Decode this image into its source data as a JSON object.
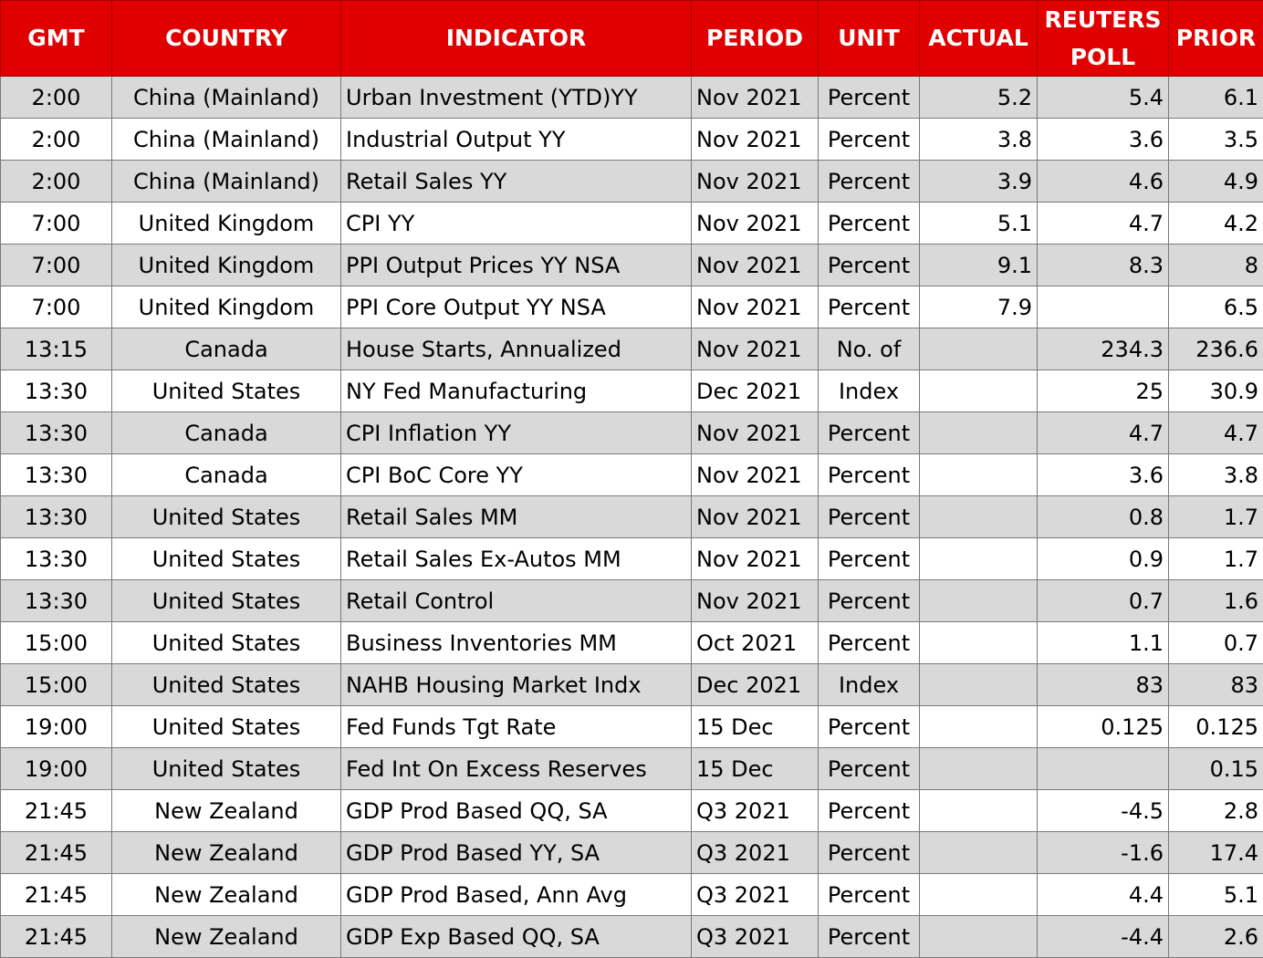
{
  "headers": {
    "gmt": "GMT",
    "country": "COUNTRY",
    "indicator": "INDICATOR",
    "period": "PERIOD",
    "unit": "UNIT",
    "actual": "ACTUAL",
    "reuters_poll": "REUTERS POLL",
    "prior": "PRIOR"
  },
  "colors": {
    "header_background": "#e00000",
    "header_text": "#ffffff",
    "row_shaded": "#d9d9d9",
    "row_plain": "#ffffff"
  },
  "rows": [
    {
      "gmt": "2:00",
      "country": "China (Mainland)",
      "indicator": "Urban Investment (YTD)YY",
      "period": "Nov 2021",
      "unit": "Percent",
      "actual": "5.2",
      "poll": "5.4",
      "prior": "6.1"
    },
    {
      "gmt": "2:00",
      "country": "China (Mainland)",
      "indicator": "Industrial Output YY",
      "period": "Nov 2021",
      "unit": "Percent",
      "actual": "3.8",
      "poll": "3.6",
      "prior": "3.5"
    },
    {
      "gmt": "2:00",
      "country": "China (Mainland)",
      "indicator": "Retail Sales YY",
      "period": "Nov 2021",
      "unit": "Percent",
      "actual": "3.9",
      "poll": "4.6",
      "prior": "4.9"
    },
    {
      "gmt": "7:00",
      "country": "United Kingdom",
      "indicator": "CPI YY",
      "period": "Nov 2021",
      "unit": "Percent",
      "actual": "5.1",
      "poll": "4.7",
      "prior": "4.2"
    },
    {
      "gmt": "7:00",
      "country": "United Kingdom",
      "indicator": "PPI Output Prices YY NSA",
      "period": "Nov 2021",
      "unit": "Percent",
      "actual": "9.1",
      "poll": "8.3",
      "prior": "8"
    },
    {
      "gmt": "7:00",
      "country": "United Kingdom",
      "indicator": "PPI Core Output YY NSA",
      "period": "Nov 2021",
      "unit": "Percent",
      "actual": "7.9",
      "poll": "",
      "prior": "6.5"
    },
    {
      "gmt": "13:15",
      "country": "Canada",
      "indicator": "House Starts, Annualized",
      "period": "Nov 2021",
      "unit": "No. of",
      "actual": "",
      "poll": "234.3",
      "prior": "236.6"
    },
    {
      "gmt": "13:30",
      "country": "United States",
      "indicator": "NY Fed Manufacturing",
      "period": "Dec 2021",
      "unit": "Index",
      "actual": "",
      "poll": "25",
      "prior": "30.9"
    },
    {
      "gmt": "13:30",
      "country": "Canada",
      "indicator": "CPI Inflation YY",
      "period": "Nov 2021",
      "unit": "Percent",
      "actual": "",
      "poll": "4.7",
      "prior": "4.7"
    },
    {
      "gmt": "13:30",
      "country": "Canada",
      "indicator": "CPI BoC Core YY",
      "period": "Nov 2021",
      "unit": "Percent",
      "actual": "",
      "poll": "3.6",
      "prior": "3.8"
    },
    {
      "gmt": "13:30",
      "country": "United States",
      "indicator": "Retail Sales MM",
      "period": "Nov 2021",
      "unit": "Percent",
      "actual": "",
      "poll": "0.8",
      "prior": "1.7"
    },
    {
      "gmt": "13:30",
      "country": "United States",
      "indicator": "Retail Sales Ex-Autos MM",
      "period": "Nov 2021",
      "unit": "Percent",
      "actual": "",
      "poll": "0.9",
      "prior": "1.7"
    },
    {
      "gmt": "13:30",
      "country": "United States",
      "indicator": "Retail Control",
      "period": "Nov 2021",
      "unit": "Percent",
      "actual": "",
      "poll": "0.7",
      "prior": "1.6"
    },
    {
      "gmt": "15:00",
      "country": "United States",
      "indicator": "Business Inventories MM",
      "period": "Oct 2021",
      "unit": "Percent",
      "actual": "",
      "poll": "1.1",
      "prior": "0.7"
    },
    {
      "gmt": "15:00",
      "country": "United States",
      "indicator": "NAHB Housing Market Indx",
      "period": "Dec 2021",
      "unit": "Index",
      "actual": "",
      "poll": "83",
      "prior": "83"
    },
    {
      "gmt": "19:00",
      "country": "United States",
      "indicator": "Fed Funds Tgt Rate",
      "period": "15 Dec",
      "unit": "Percent",
      "actual": "",
      "poll": "0.125",
      "prior": "0.125"
    },
    {
      "gmt": "19:00",
      "country": "United States",
      "indicator": "Fed Int On Excess Reserves",
      "period": "15 Dec",
      "unit": "Percent",
      "actual": "",
      "poll": "",
      "prior": "0.15"
    },
    {
      "gmt": "21:45",
      "country": "New Zealand",
      "indicator": "GDP Prod Based QQ, SA",
      "period": "Q3 2021",
      "unit": "Percent",
      "actual": "",
      "poll": "-4.5",
      "prior": "2.8"
    },
    {
      "gmt": "21:45",
      "country": "New Zealand",
      "indicator": "GDP Prod Based YY, SA",
      "period": "Q3 2021",
      "unit": "Percent",
      "actual": "",
      "poll": "-1.6",
      "prior": "17.4"
    },
    {
      "gmt": "21:45",
      "country": "New Zealand",
      "indicator": "GDP Prod Based, Ann Avg",
      "period": "Q3 2021",
      "unit": "Percent",
      "actual": "",
      "poll": "4.4",
      "prior": "5.1"
    },
    {
      "gmt": "21:45",
      "country": "New Zealand",
      "indicator": "GDP Exp Based QQ, SA",
      "period": "Q3 2021",
      "unit": "Percent",
      "actual": "",
      "poll": "-4.4",
      "prior": "2.6"
    }
  ]
}
